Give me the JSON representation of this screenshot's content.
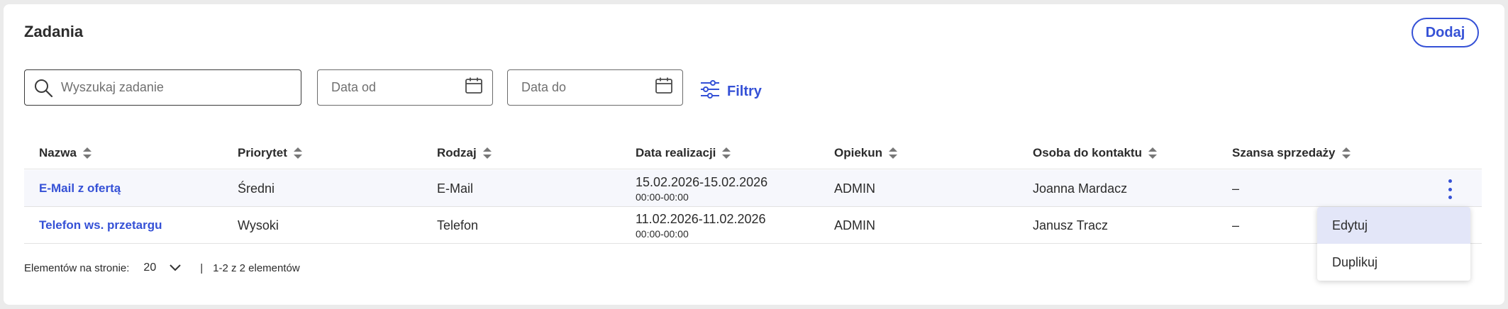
{
  "page": {
    "title": "Zadania",
    "add_label": "Dodaj"
  },
  "toolbar": {
    "search_placeholder": "Wyszukaj zadanie",
    "date_from_placeholder": "Data od",
    "date_to_placeholder": "Data do",
    "filters_label": "Filtry"
  },
  "table": {
    "columns": [
      "Nazwa",
      "Priorytet",
      "Rodzaj",
      "Data realizacji",
      "Opiekun",
      "Osoba do kontaktu",
      "Szansa sprzedaży"
    ],
    "rows": [
      {
        "name": "E-Mail z ofertą",
        "priority": "Średni",
        "type": "E-Mail",
        "date": "15.02.2026-15.02.2026",
        "time": "00:00-00:00",
        "owner": "ADMIN",
        "contact": "Joanna Mardacz",
        "chance": "–"
      },
      {
        "name": "Telefon ws. przetargu",
        "priority": "Wysoki",
        "type": "Telefon",
        "date": "11.02.2026-11.02.2026",
        "time": "00:00-00:00",
        "owner": "ADMIN",
        "contact": "Janusz Tracz",
        "chance": "–"
      }
    ]
  },
  "footer": {
    "per_page_label": "Elementów na stronie:",
    "per_page_value": "20",
    "separator": "|",
    "range_text": "1-2 z 2 elementów"
  },
  "context_menu": {
    "items": [
      "Edytuj",
      "Duplikuj"
    ]
  },
  "colors": {
    "accent": "#3551d6",
    "row_highlight": "#f6f7fc",
    "menu_active": "#e3e6f8"
  }
}
